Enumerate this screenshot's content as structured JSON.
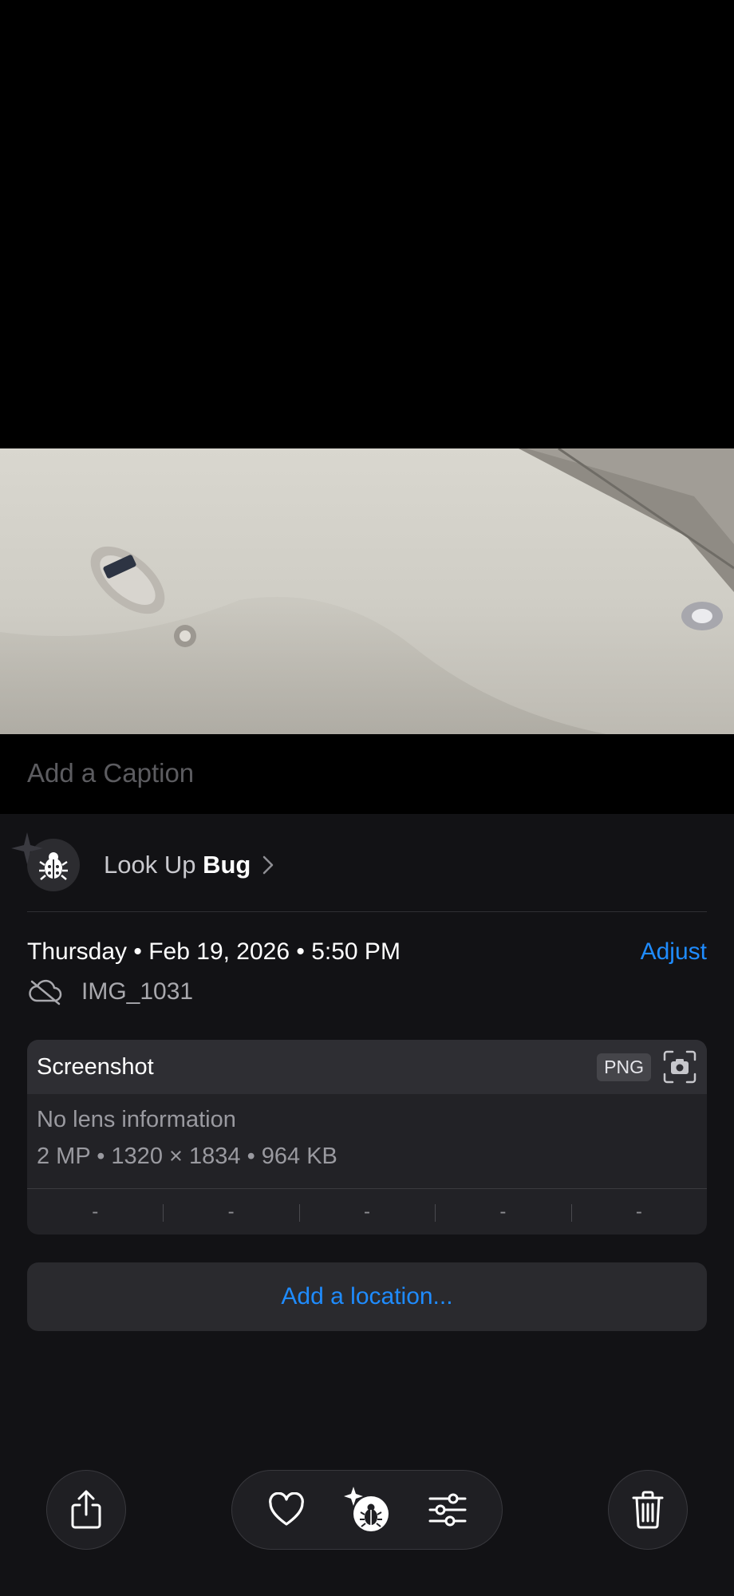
{
  "caption": {
    "placeholder": "Add a Caption"
  },
  "lookup": {
    "prefix": "Look Up",
    "subject": "Bug"
  },
  "info": {
    "date": "Thursday • Feb 19, 2026 • 5:50 PM",
    "adjust_label": "Adjust",
    "filename": "IMG_1031"
  },
  "card": {
    "title": "Screenshot",
    "format_badge": "PNG",
    "lens": "No lens information",
    "meta": "2 MP • 1320 × 1834 • 964 KB",
    "exif": [
      "-",
      "-",
      "-",
      "-",
      "-"
    ]
  },
  "location": {
    "label": "Add a location..."
  },
  "colors": {
    "accent": "#1f8cff",
    "sheet_bg": "#121215"
  }
}
